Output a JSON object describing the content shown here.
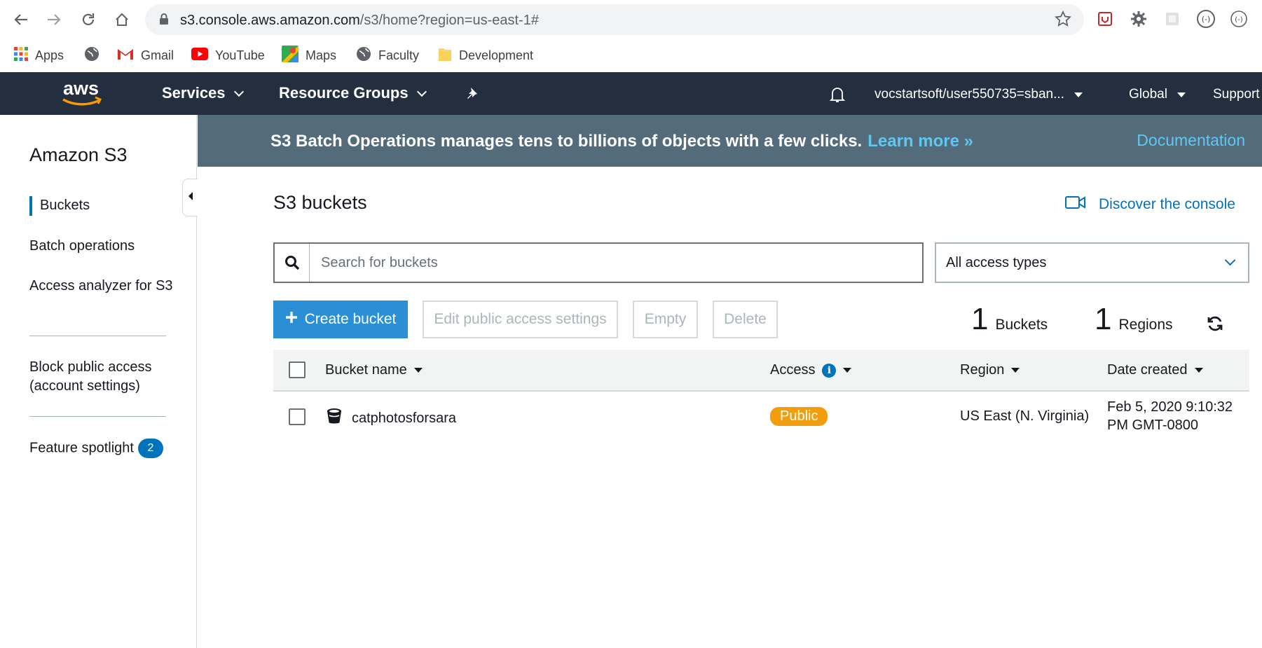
{
  "browser": {
    "url_host": "s3.console.aws.amazon.com",
    "url_path": "/s3/home?region=us-east-1#",
    "bookmarks": [
      {
        "label": "Apps",
        "icon": "apps-grid-icon"
      },
      {
        "label": "",
        "icon": "globe-icon"
      },
      {
        "label": "Gmail",
        "icon": "gmail-icon"
      },
      {
        "label": "YouTube",
        "icon": "youtube-icon"
      },
      {
        "label": "Maps",
        "icon": "maps-icon"
      },
      {
        "label": "Faculty",
        "icon": "globe-icon"
      },
      {
        "label": "Development",
        "icon": "folder-icon"
      }
    ]
  },
  "aws_nav": {
    "logo": "aws",
    "services": "Services",
    "resource_groups": "Resource Groups",
    "account": "vocstartsoft/user550735=sban...",
    "region": "Global",
    "support": "Support"
  },
  "sidebar": {
    "title": "Amazon S3",
    "items": [
      {
        "label": "Buckets",
        "active": true
      },
      {
        "label": "Batch operations"
      },
      {
        "label": "Access analyzer for S3"
      },
      {
        "label": "Block public access (account settings)"
      },
      {
        "label": "Feature spotlight",
        "badge": "2"
      }
    ]
  },
  "banner": {
    "message": "S3 Batch Operations manages tens to billions of objects with a few clicks.",
    "link": "Learn more »",
    "documentation": "Documentation"
  },
  "main": {
    "title": "S3 buckets",
    "discover": "Discover the console",
    "search_placeholder": "Search for buckets",
    "access_filter": "All access types",
    "buttons": {
      "create": "Create bucket",
      "edit_public": "Edit public access settings",
      "empty": "Empty",
      "delete": "Delete"
    },
    "bucket_count": "1",
    "bucket_label": "Buckets",
    "region_count": "1",
    "region_label": "Regions"
  },
  "table": {
    "columns": [
      "Bucket name",
      "Access",
      "Region",
      "Date created"
    ],
    "rows": [
      {
        "name": "catphotosforsara",
        "access": "Public",
        "region": "US East (N. Virginia)",
        "date_line1": "Feb 5, 2020 9:10:32",
        "date_line2": "PM GMT-0800"
      }
    ]
  },
  "colors": {
    "aws_nav": "#232f3e",
    "banner": "#546b7c",
    "primary": "#2b8fd6",
    "link": "#0073bb",
    "public_badge": "#f29d0c"
  }
}
